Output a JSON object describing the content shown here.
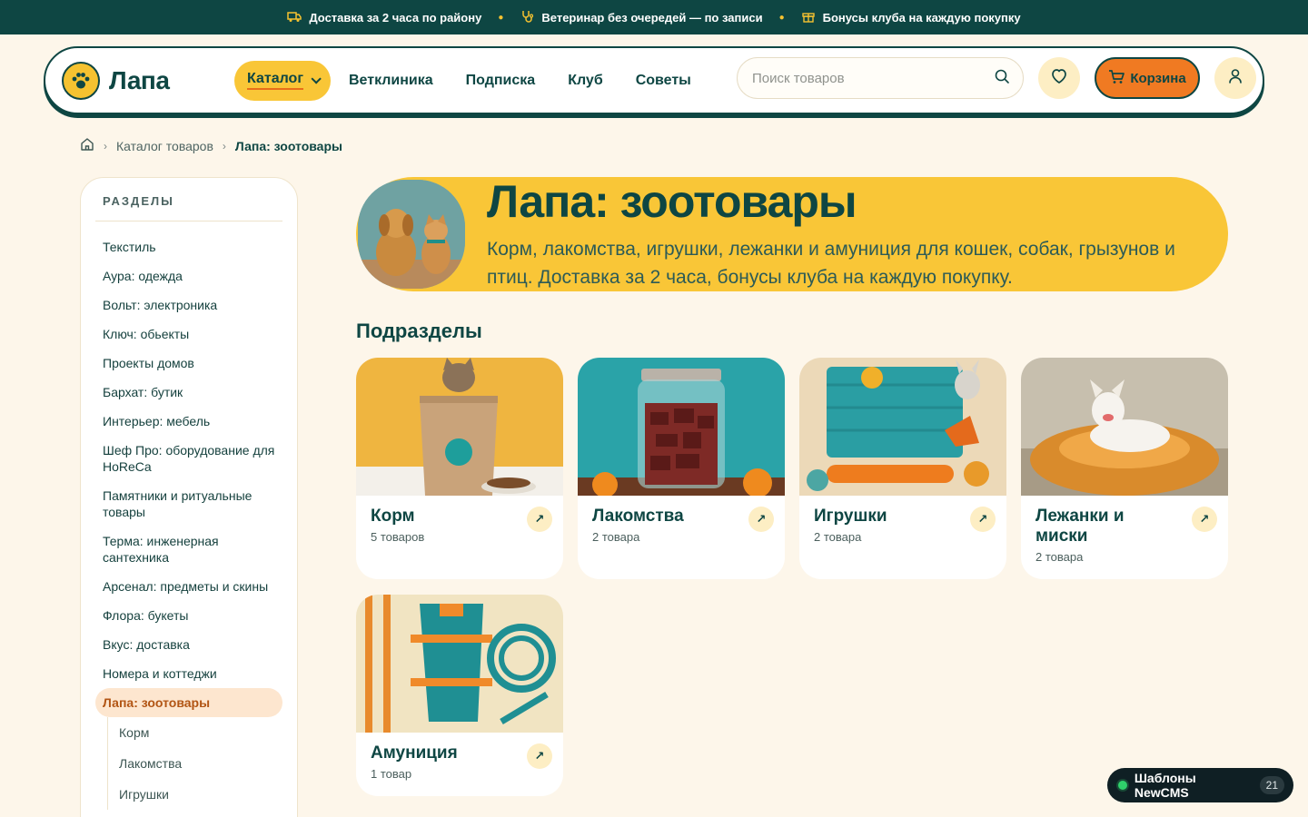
{
  "topbar": {
    "items": [
      {
        "icon": "truck-icon",
        "text": "Доставка за 2 часа по району"
      },
      {
        "icon": "stethoscope-icon",
        "text": "Ветеринар без очередей — по записи"
      },
      {
        "icon": "gift-icon",
        "text": "Бонусы клуба на каждую покупку"
      }
    ]
  },
  "header": {
    "logo_text": "Лапа",
    "nav": [
      "Каталог",
      "Ветклиника",
      "Подписка",
      "Клуб",
      "Советы"
    ],
    "search_placeholder": "Поиск товаров",
    "cart_label": "Корзина"
  },
  "breadcrumbs": {
    "catalog": "Каталог товаров",
    "current": "Лапа: зоотовары"
  },
  "sidebar": {
    "heading": "РАЗДЕЛЫ",
    "items": [
      "Текстиль",
      "Аура: одежда",
      "Вольт: электроника",
      "Ключ: обьекты",
      "Проекты домов",
      "Бархат: бутик",
      "Интерьер: мебель",
      "Шеф Про: оборудование для HoReCa",
      "Памятники и ритуальные товары",
      "Терма: инженерная сантехника",
      "Арсенал: предметы и скины",
      "Флора: букеты",
      "Вкус: доставка",
      "Номера и коттеджи"
    ],
    "active_item": "Лапа: зоотовары",
    "sub_items": [
      "Корм",
      "Лакомства",
      "Игрушки"
    ]
  },
  "hero": {
    "title": "Лапа: зоотовары",
    "description": "Корм, лакомства, игрушки, лежанки и амуниция для кошек, собак, грызунов и птиц. Доставка за 2 часа, бонусы клуба на каждую покупку."
  },
  "subsections": {
    "title": "Подразделы",
    "cards": [
      {
        "title": "Корм",
        "count": "5 товаров"
      },
      {
        "title": "Лакомства",
        "count": "2 товара"
      },
      {
        "title": "Игрушки",
        "count": "2 товара"
      },
      {
        "title": "Лежанки и миски",
        "count": "2 товара"
      },
      {
        "title": "Амуниция",
        "count": "1 товар"
      }
    ]
  },
  "widget": {
    "label": "Шаблоны NewCMS",
    "count": "21"
  },
  "colors": {
    "brand_dark": "#0e4643",
    "brand_yellow": "#f9c637",
    "accent_orange": "#f07a22",
    "background": "#fdf6ea"
  }
}
